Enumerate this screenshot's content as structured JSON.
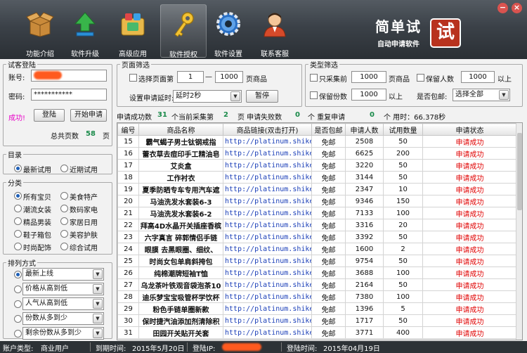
{
  "colors": {
    "accent_red": "#e00000",
    "link_blue": "#1b3fb8",
    "stat_green": "#1a8a4a",
    "toolbar_bg": "#3b4148"
  },
  "toolbar": {
    "items": [
      {
        "label": "功能介绍",
        "icon": "box-icon"
      },
      {
        "label": "软件升级",
        "icon": "upgrade-arrow-icon"
      },
      {
        "label": "高级应用",
        "icon": "apps-folder-icon"
      },
      {
        "label": "软件授权",
        "icon": "key-icon"
      },
      {
        "label": "软件设置",
        "icon": "gear-icon"
      },
      {
        "label": "联系客服",
        "icon": "support-agent-icon"
      }
    ],
    "active_index": 3
  },
  "brand": {
    "title": "简单试",
    "subtitle": "自动申请软件",
    "logo": "试"
  },
  "window": {
    "min": "−",
    "close": "×"
  },
  "login": {
    "legend": "试客登陆",
    "account_label": "账号:",
    "account_value": "",
    "password_label": "密码:",
    "password_value": "***********",
    "status": "成功!",
    "login_button": "登陆",
    "start_button": "开始申请",
    "total_pages_label": "总共页数",
    "total_pages": "58",
    "pages_unit": "页"
  },
  "directory": {
    "legend": "目录",
    "options": [
      {
        "label": "最新试用",
        "checked": true
      },
      {
        "label": "近期试用",
        "checked": false
      }
    ]
  },
  "category": {
    "legend": "分类",
    "options": [
      {
        "label": "所有宝贝",
        "checked": true
      },
      {
        "label": "美食特产",
        "checked": false
      },
      {
        "label": "潮流女装",
        "checked": false
      },
      {
        "label": "数码家电",
        "checked": false
      },
      {
        "label": "精品男装",
        "checked": false
      },
      {
        "label": "家居日用",
        "checked": false
      },
      {
        "label": "鞋子箱包",
        "checked": false
      },
      {
        "label": "美容护肤",
        "checked": false
      },
      {
        "label": "时尚配饰",
        "checked": false
      },
      {
        "label": "综合试用",
        "checked": false
      }
    ]
  },
  "sort": {
    "legend": "排列方式",
    "options": [
      {
        "label": "最新上线",
        "checked": true
      },
      {
        "label": "价格从高到低",
        "checked": false
      },
      {
        "label": "人气从高到低",
        "checked": false
      },
      {
        "label": "份数从多到少",
        "checked": false
      },
      {
        "label": "剩余份数从多到少",
        "checked": false
      }
    ]
  },
  "page_filter": {
    "legend": "页面筛选",
    "select_page_label": "选择页面第",
    "from": "1",
    "dash": "—",
    "to": "1000",
    "unit": "页商品",
    "delay_label": "设置申请延时:",
    "delay_value": "延时2秒",
    "pause_button": "暂停"
  },
  "type_filter": {
    "legend": "类型筛选",
    "only_collect_label": "只采集前",
    "only_collect_value": "1000",
    "only_collect_unit": "页商品",
    "keep_people_label": "保留人数",
    "keep_people_value": "1000",
    "keep_people_unit": "以上",
    "keep_share_label": "保留份数",
    "keep_share_value": "1000",
    "keep_share_unit": "以上",
    "free_ship_label": "是否包邮:",
    "free_ship_value": "选择全部"
  },
  "stats": {
    "success_label": "申请成功数",
    "success_count": "31",
    "current_label": "个当前采集第",
    "current_page": "2",
    "fail_label": "页 申请失败数",
    "fail_count": "0",
    "dup_label": "个 重复申请",
    "dup_count": "0",
    "time_label": "个 用时：66.378秒"
  },
  "table": {
    "headers": [
      "编号",
      "商品名称",
      "商品链接(双击打开)",
      "是否包邮",
      "申请人数",
      "试用数量",
      "申请状态"
    ],
    "rows": [
      [
        "15",
        "霸气蝎子男士钛钢戒指",
        "http://platinum.shikee.co",
        "免邮",
        "2508",
        "50",
        "申请成功"
      ],
      [
        "16",
        "蕾衣草去痘印手工精油皂",
        "http://platinum.shikee.co",
        "免邮",
        "6625",
        "200",
        "申请成功"
      ],
      [
        "17",
        "艾炎盒",
        "http://platinum.shikee.co",
        "免邮",
        "3220",
        "50",
        "申请成功"
      ],
      [
        "18",
        "工作衬衣",
        "http://platinum.shikee.co",
        "免邮",
        "3144",
        "50",
        "申请成功"
      ],
      [
        "19",
        "夏季防晒专车专用汽车遮",
        "http://platinum.shikee.co",
        "免邮",
        "2347",
        "10",
        "申请成功"
      ],
      [
        "20",
        "马油洗发水套装6-3",
        "http://platinum.shikee.co",
        "免邮",
        "9346",
        "150",
        "申请成功"
      ],
      [
        "21",
        "马油洗发水套装6-2",
        "http://platinum.shikee.co",
        "免邮",
        "7133",
        "100",
        "申请成功"
      ],
      [
        "22",
        "拜高4D水晶开关插座香槟",
        "http://platinum.shikee.co",
        "免邮",
        "3316",
        "20",
        "申请成功"
      ],
      [
        "23",
        "六字真言 碎郭情侣手链",
        "http://platinum.shikee.co",
        "免邮",
        "3392",
        "50",
        "申请成功"
      ],
      [
        "24",
        "眼膜  去黑眼圈、细纹、",
        "http://platinum.shikee.co",
        "免邮",
        "1600",
        "2",
        "申请成功"
      ],
      [
        "25",
        "时尚女包单肩斜挎包",
        "http://platinum.shikee.co",
        "免邮",
        "9754",
        "50",
        "申请成功"
      ],
      [
        "26",
        "纯棉潮牌短袖T恤",
        "http://platinum.shikee.co",
        "免邮",
        "3688",
        "100",
        "申请成功"
      ],
      [
        "27",
        "乌龙茶叶铁观音袋泡茶10",
        "http://platinum.shikee.co",
        "免邮",
        "2164",
        "50",
        "申请成功"
      ],
      [
        "28",
        "迪乐梦宝宝吸管杯学饮杯",
        "http://platinum.shikee.co",
        "免邮",
        "7380",
        "100",
        "申请成功"
      ],
      [
        "29",
        "粉色手链单圈新款",
        "http://platinum.shikee.co",
        "免邮",
        "1396",
        "5",
        "申请成功"
      ],
      [
        "30",
        "保时捷汽油添加剂清除积",
        "http://platinum.shikee.co",
        "免邮",
        "1717",
        "50",
        "申请成功"
      ],
      [
        "31",
        "田园开关贴开关套",
        "http://platinum.shikee.co",
        "免邮",
        "3771",
        "400",
        "申请成功"
      ]
    ]
  },
  "statusbar": {
    "account_type_label": "账户类型:",
    "account_type": "商业用户",
    "expire_label": "到期时间:",
    "expire_value": "2015年5月20日",
    "login_ip_label": "登陆IP:",
    "login_ip_value": "",
    "login_time_label": "登陆时间:",
    "login_time_value": "2015年04月19日"
  }
}
